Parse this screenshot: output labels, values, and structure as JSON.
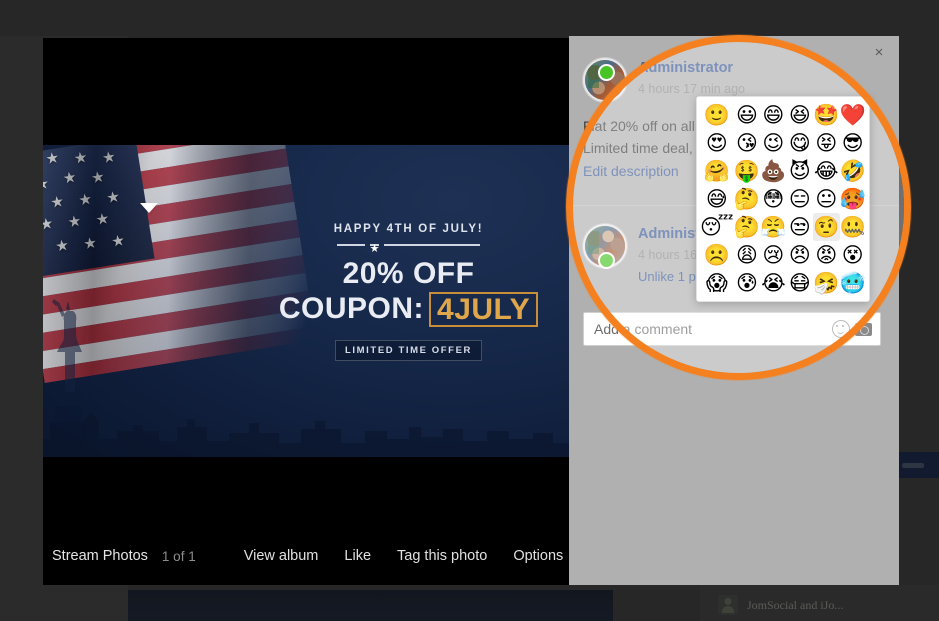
{
  "background": {
    "user_row": {
      "name": "JomSocial and iJo..."
    }
  },
  "lightbox": {
    "photo": {
      "headline": "HAPPY 4TH OF JULY!",
      "star_glyph": "★",
      "discount": "20% OFF",
      "coupon_label": "COUPON:",
      "coupon_code": "4JULY",
      "limited": "LIMITED TIME OFFER",
      "accent_color": "#e0a64a",
      "bg_color": "#16284a"
    },
    "bottom_bar": {
      "stream_label": "Stream Photos",
      "counter": "1 of 1",
      "actions": [
        "View album",
        "Like",
        "Tag this photo",
        "Options"
      ]
    }
  },
  "sidebar": {
    "close_glyph": "×",
    "post": {
      "author": "Administrator",
      "timestamp": "4 hours 17 min ago",
      "body_line1": "Flat 20% off on all products.",
      "body_line2": "Limited time deal, hurry up!",
      "edit_link": "Edit description"
    },
    "comment": {
      "author": "Administrator",
      "timestamp": "4 hours 16 min ago",
      "actions": "Unlike 1 person likes this."
    },
    "composer": {
      "placeholder": "Add a comment",
      "smiley_icon": "smiley-icon",
      "camera_icon": "camera-icon"
    }
  },
  "emoji_picker": {
    "columns": 6,
    "hover_index": 28,
    "emojis": [
      "🙂",
      "😃",
      "😄",
      "😆",
      "🤩",
      "❤️",
      "😍",
      "😘",
      "😉",
      "😋",
      "😝",
      "😎",
      "🤗",
      "🤑",
      "💩",
      "😈",
      "😂",
      "🤣",
      "😅",
      "🤔",
      "😳",
      "😑",
      "😐",
      "🥵",
      "😴",
      "🤔",
      "😤",
      "😒",
      "🤨",
      "🤐",
      "☹️",
      "😩",
      "😢",
      "😠",
      "😡",
      "😵",
      "😱",
      "😰",
      "😭",
      "😷",
      "🤧",
      "🥶"
    ],
    "names": [
      "slightly-smiling-face",
      "grinning-face",
      "smiling-face-open-mouth",
      "grinning-squinting-face",
      "star-struck-face",
      "red-heart",
      "heart-eyes-face",
      "face-blowing-kiss",
      "winking-face",
      "face-savoring-food",
      "squinting-face-tongue",
      "smiling-face-sunglasses",
      "hugging-face",
      "money-mouth-face",
      "pile-of-poo",
      "smiling-face-horns",
      "face-with-tears-of-joy",
      "rolling-on-floor-laughing",
      "grinning-face-sweat",
      "thinking-face",
      "flushed-face",
      "expressionless-face",
      "neutral-face",
      "face-with-open-eyes-hand-over-mouth",
      "sleeping-face",
      "thinking-face-hand",
      "face-with-steam-from-nose",
      "unamused-face",
      "face-with-raised-eyebrow",
      "zipper-mouth-face",
      "frowning-face",
      "weary-face",
      "sad-but-relieved-face",
      "angry-face",
      "pouting-face",
      "dizzy-face",
      "face-screaming-in-fear",
      "anxious-face-with-sweat",
      "loudly-crying-face",
      "face-with-medical-mask",
      "sneezing-face",
      "cold-face"
    ]
  },
  "highlight": {
    "color": "#f4801f",
    "shape": "circle-annotation"
  }
}
